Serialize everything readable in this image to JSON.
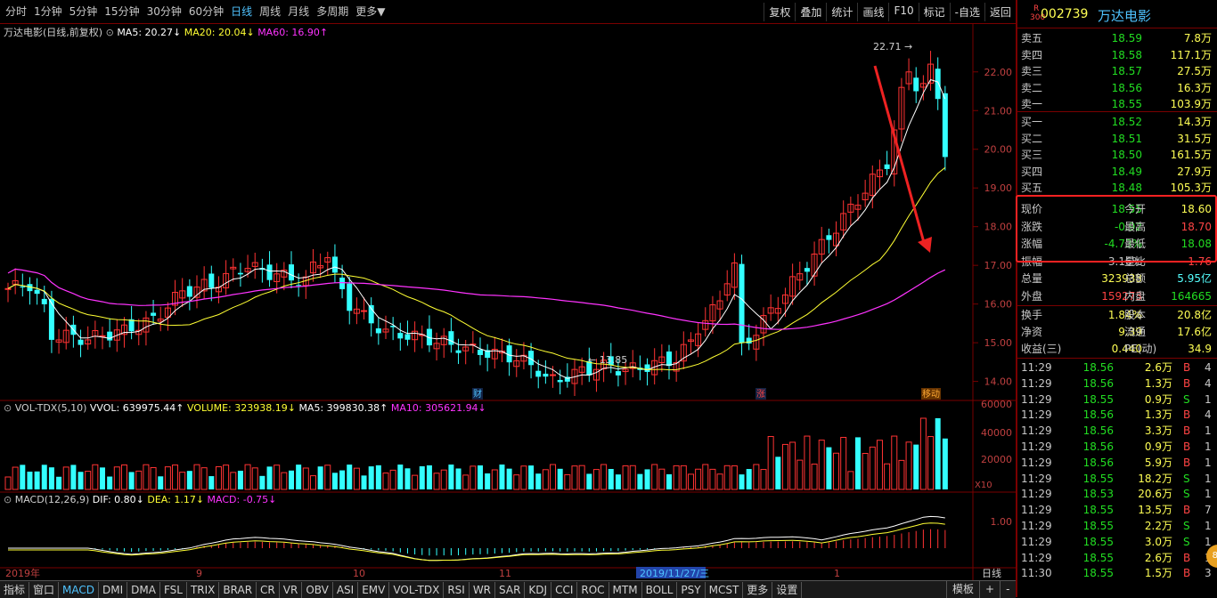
{
  "toolbar": {
    "periods": [
      "分时",
      "1分钟",
      "5分钟",
      "15分钟",
      "30分钟",
      "60分钟",
      "日线",
      "周线",
      "月线",
      "多周期",
      "更多▼"
    ],
    "active_period": "日线",
    "buttons": [
      "复权",
      "叠加",
      "统计",
      "画线",
      "F10",
      "标记",
      "-自选",
      "返回"
    ]
  },
  "main_legend": {
    "title": "万达电影(日线,前复权)",
    "ma5": "MA5: 20.27↓",
    "ma20": "MA20: 20.04↓",
    "ma60": "MA60: 16.90↑"
  },
  "vol_legend": {
    "name": "VOL-TDX(5,10)",
    "vvol": "VVOL: 639975.44↑",
    "volume": "VOLUME: 323938.19↓",
    "ma5": "MA5: 399830.38↑",
    "ma10": "MA10: 305621.94↓"
  },
  "macd_legend": {
    "name": "MACD(12,26,9)",
    "dif": "DIF: 0.80↓",
    "dea": "DEA: 1.17↓",
    "macd": "MACD: -0.75↓"
  },
  "chart_data": {
    "type": "candlestick",
    "price_axis_ticks": [
      "22.00",
      "21.00",
      "20.00",
      "19.00",
      "18.00",
      "17.00",
      "16.00",
      "15.00",
      "14.00"
    ],
    "ylim": [
      13.6,
      22.8
    ],
    "high_label": "22.71",
    "low_label": "13.85",
    "vol_axis_ticks": [
      "60000",
      "40000",
      "20000"
    ],
    "vol_unit": "X10",
    "macd_axis_ticks": [
      "1.00"
    ],
    "x_labels": [
      "2019年",
      "9",
      "10",
      "11",
      "2019/11/27/三",
      "1"
    ],
    "markers": [
      "财",
      "涨",
      "移动"
    ],
    "macd_tab": "日线"
  },
  "stock": {
    "code": "002739",
    "name": "万达电影",
    "badge_r": "R",
    "badge_num": "300"
  },
  "order_book": {
    "asks": [
      {
        "label": "卖五",
        "price": "18.59",
        "vol": "7.8万"
      },
      {
        "label": "卖四",
        "price": "18.58",
        "vol": "117.1万"
      },
      {
        "label": "卖三",
        "price": "18.57",
        "vol": "27.5万"
      },
      {
        "label": "卖二",
        "price": "18.56",
        "vol": "16.3万"
      },
      {
        "label": "卖一",
        "price": "18.55",
        "vol": "103.9万"
      }
    ],
    "bids": [
      {
        "label": "买一",
        "price": "18.52",
        "vol": "14.3万"
      },
      {
        "label": "买二",
        "price": "18.51",
        "vol": "31.5万"
      },
      {
        "label": "买三",
        "price": "18.50",
        "vol": "161.5万"
      },
      {
        "label": "买四",
        "price": "18.49",
        "vol": "27.9万"
      },
      {
        "label": "买五",
        "price": "18.48",
        "vol": "105.3万"
      }
    ]
  },
  "quote": {
    "rows": [
      {
        "l1": "现价",
        "v1": "18.55",
        "l2": "今开",
        "v2": "18.60"
      },
      {
        "l1": "涨跌",
        "v1": "-0.92",
        "l2": "最高",
        "v2": "18.70"
      },
      {
        "l1": "涨幅",
        "v1": "-4.73%",
        "l2": "最低",
        "v2": "18.08"
      },
      {
        "l1": "振幅",
        "v1": "3.16%",
        "l2": "量比",
        "v2": "1.76"
      },
      {
        "l1": "总量",
        "v1": "323938",
        "l2": "总额",
        "v2": "5.95亿"
      },
      {
        "l1": "外盘",
        "v1": "159273",
        "l2": "内盘",
        "v2": "164665"
      }
    ],
    "fund": [
      {
        "l1": "换手",
        "v1": "1.84%",
        "l2": "股本",
        "v2": "20.8亿"
      },
      {
        "l1": "净资",
        "v1": "9.39",
        "l2": "流通",
        "v2": "17.6亿"
      },
      {
        "l1": "收益(三)",
        "v1": "0.440",
        "l2": "PE(动)",
        "v2": "34.9"
      }
    ]
  },
  "ticks": [
    {
      "t": "11:29",
      "p": "18.56",
      "v": "2.6万",
      "bs": "B",
      "n": "4"
    },
    {
      "t": "11:29",
      "p": "18.56",
      "v": "1.3万",
      "bs": "B",
      "n": "4"
    },
    {
      "t": "11:29",
      "p": "18.55",
      "v": "0.9万",
      "bs": "S",
      "n": "1"
    },
    {
      "t": "11:29",
      "p": "18.56",
      "v": "1.3万",
      "bs": "B",
      "n": "4"
    },
    {
      "t": "11:29",
      "p": "18.56",
      "v": "3.3万",
      "bs": "B",
      "n": "1"
    },
    {
      "t": "11:29",
      "p": "18.56",
      "v": "0.9万",
      "bs": "B",
      "n": "1"
    },
    {
      "t": "11:29",
      "p": "18.56",
      "v": "5.9万",
      "bs": "B",
      "n": "1"
    },
    {
      "t": "11:29",
      "p": "18.55",
      "v": "18.2万",
      "bs": "S",
      "n": "1"
    },
    {
      "t": "11:29",
      "p": "18.53",
      "v": "20.6万",
      "bs": "S",
      "n": "1"
    },
    {
      "t": "11:29",
      "p": "18.55",
      "v": "13.5万",
      "bs": "B",
      "n": "7"
    },
    {
      "t": "11:29",
      "p": "18.55",
      "v": "2.2万",
      "bs": "S",
      "n": "1"
    },
    {
      "t": "11:29",
      "p": "18.55",
      "v": "3.0万",
      "bs": "S",
      "n": "1"
    },
    {
      "t": "11:29",
      "p": "18.55",
      "v": "2.6万",
      "bs": "B",
      "n": "1"
    },
    {
      "t": "11:30",
      "p": "18.55",
      "v": "1.5万",
      "bs": "B",
      "n": "3"
    }
  ],
  "bottom_tabs": [
    "指标",
    "窗口",
    "MACD",
    "DMI",
    "DMA",
    "FSL",
    "TRIX",
    "BRAR",
    "CR",
    "VR",
    "OBV",
    "ASI",
    "EMV",
    "VOL-TDX",
    "RSI",
    "WR",
    "SAR",
    "KDJ",
    "CCI",
    "ROC",
    "MTM",
    "BOLL",
    "PSY",
    "MCST",
    "更多",
    "设置"
  ],
  "bottom_right": [
    "模板",
    "+",
    "-"
  ],
  "avatar_badge": "89",
  "colors": {
    "up": "#ff3333",
    "down": "#33ffff",
    "ma5": "#ffffff",
    "ma20": "#ffff33",
    "ma60": "#ff33ff",
    "highlight_box": "#ff2222"
  }
}
